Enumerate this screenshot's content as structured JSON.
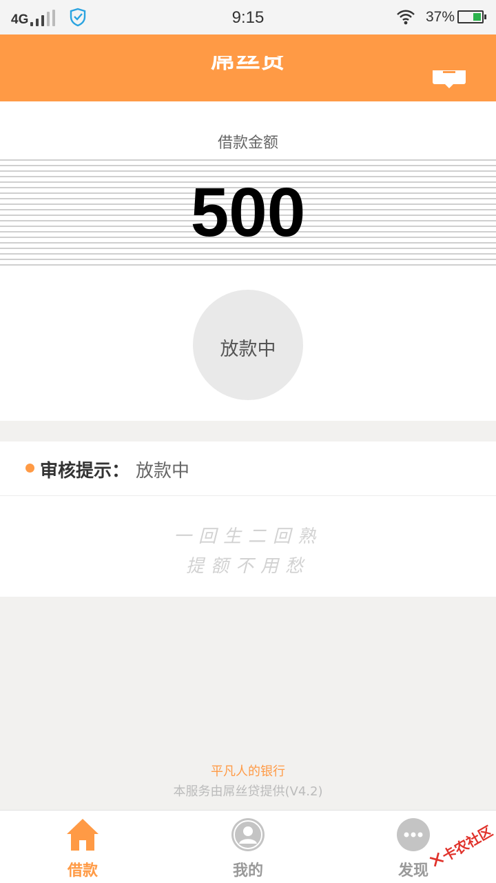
{
  "status_bar": {
    "network": "4G",
    "time": "9:15",
    "battery": "37%",
    "battery_level": 0.37
  },
  "header": {
    "title": "屌丝贷",
    "message_icon": "message-icon"
  },
  "loan": {
    "label": "借款金额",
    "amount": "500",
    "status_button": "放款中"
  },
  "review": {
    "label": "审核提示：",
    "value": "放款中"
  },
  "slogan": {
    "line1": "一回生二回熟",
    "line2": "提额不用愁"
  },
  "footer": {
    "tagline": "平凡人的银行",
    "provider": "本服务由屌丝贷提供(V4.2)"
  },
  "tabs": [
    {
      "label": "借款",
      "icon": "home-icon",
      "active": true
    },
    {
      "label": "我的",
      "icon": "user-icon",
      "active": false
    },
    {
      "label": "发现",
      "icon": "more-icon",
      "active": false
    }
  ],
  "watermark": {
    "text": "卡农社区"
  },
  "colors": {
    "accent": "#ff9a45",
    "background": "#f2f1ef"
  }
}
